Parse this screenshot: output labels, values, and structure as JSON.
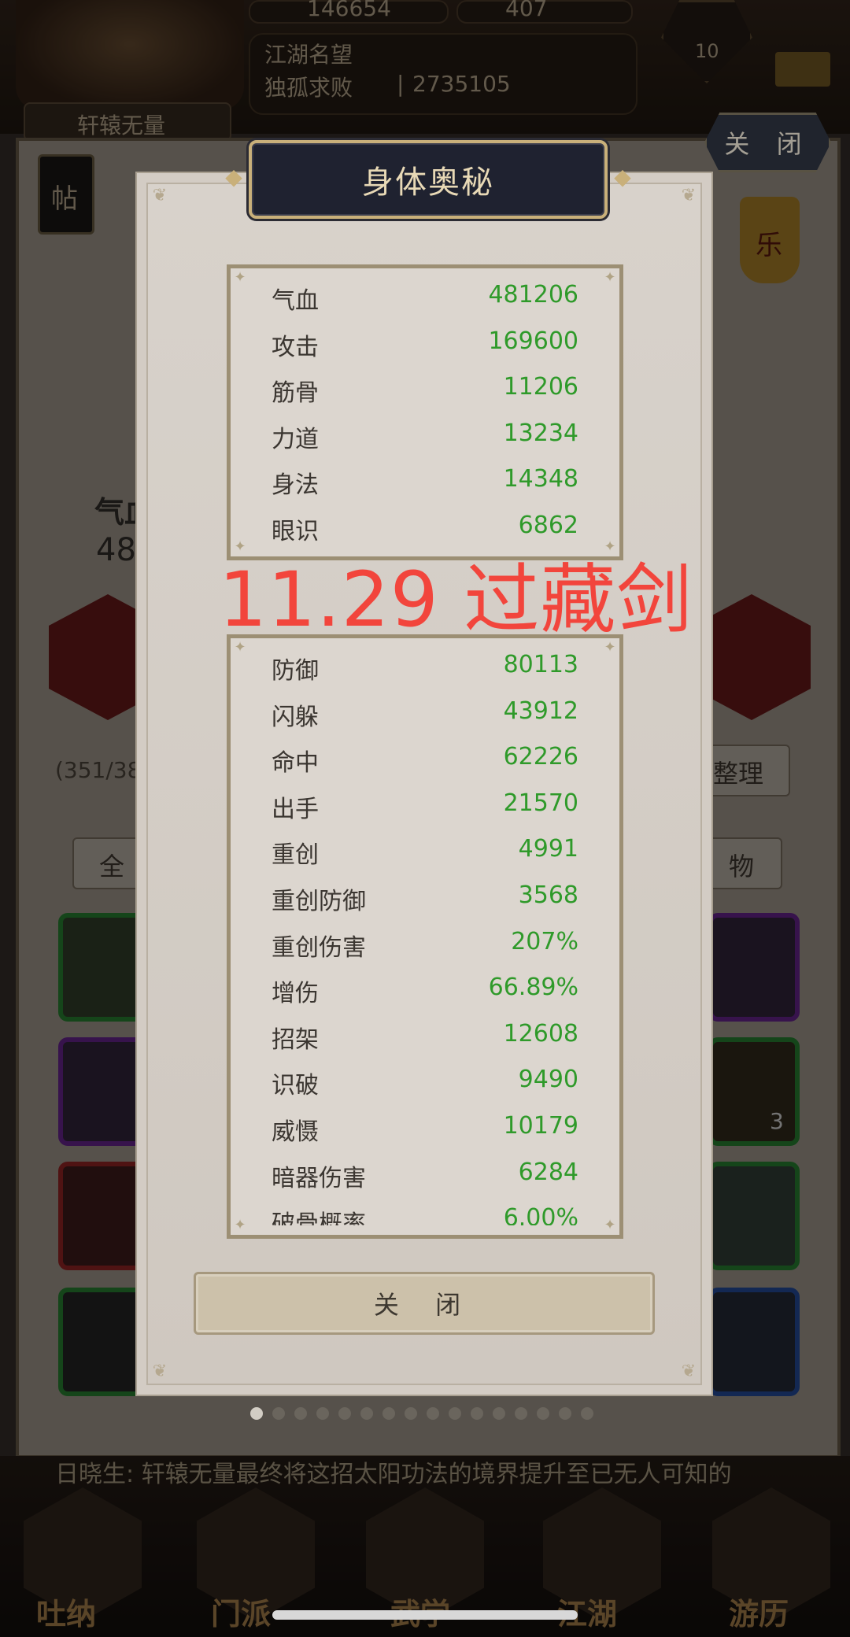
{
  "background": {
    "resource_1": "146654",
    "resource_2": "407",
    "taiji_level": "10",
    "fame_label": "江湖名望",
    "rank_name": "独孤求败",
    "rank_value": "2735105",
    "player_name": "轩辕无量",
    "post_label": "帖",
    "lantern_label": "乐",
    "stat_partial_label": "气血",
    "stat_partial_value": "48",
    "bag_count": "(351/38",
    "sort_button": "整理",
    "tab_all": "全",
    "tab_items": "物",
    "slot_count": "3",
    "scroll_text": "日晓生: 轩辕无量最终将这招太阳功法的境界提升至已无人可知的",
    "footer_tabs": [
      "吐纳",
      "门派",
      "武学",
      "江湖",
      "游历"
    ],
    "top_close_label": "关 闭"
  },
  "modal": {
    "title": "身体奥秘",
    "overlay_annotation": "11.29 过藏剑",
    "close_label": "关 闭",
    "page_dots_total": 16,
    "page_dots_active_index": 0
  },
  "stats_primary": [
    {
      "label": "气血",
      "value": "481206"
    },
    {
      "label": "攻击",
      "value": "169600"
    },
    {
      "label": "筋骨",
      "value": "11206"
    },
    {
      "label": "力道",
      "value": "13234"
    },
    {
      "label": "身法",
      "value": "14348"
    },
    {
      "label": "眼识",
      "value": "6862"
    }
  ],
  "stats_secondary": [
    {
      "label": "防御",
      "value": "80113"
    },
    {
      "label": "闪躲",
      "value": "43912"
    },
    {
      "label": "命中",
      "value": "62226"
    },
    {
      "label": "出手",
      "value": "21570"
    },
    {
      "label": "重创",
      "value": "4991"
    },
    {
      "label": "重创防御",
      "value": "3568"
    },
    {
      "label": "重创伤害",
      "value": "207%"
    },
    {
      "label": "增伤",
      "value": "66.89%"
    },
    {
      "label": "招架",
      "value": "12608"
    },
    {
      "label": "识破",
      "value": "9490"
    },
    {
      "label": "威慑",
      "value": "10179"
    },
    {
      "label": "暗器伤害",
      "value": "6284"
    },
    {
      "label": "破骨概率",
      "value": "6.00%"
    }
  ],
  "colors": {
    "stat_value": "#2f9a2a",
    "overlay_text": "#f2453c",
    "title_plate": "#1f2230",
    "panel_border": "#9c8f74"
  }
}
